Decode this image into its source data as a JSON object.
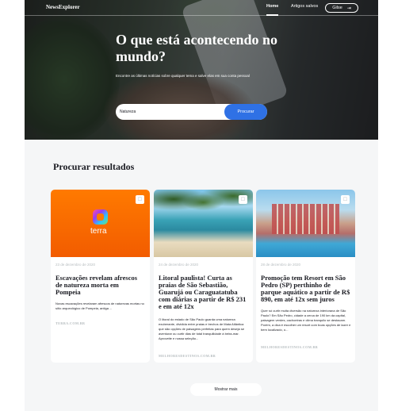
{
  "header": {
    "logo": "NewsExplorer",
    "nav": {
      "home": "Home",
      "saved": "Artigos salvos",
      "user": "Gilse"
    },
    "logout_icon": "logout-icon"
  },
  "hero": {
    "title": "O que está acontecendo no mundo?",
    "subtitle": "Encontre as últimas notícias sobre qualquer tema e salve elas em sua conta pessoal",
    "search": {
      "value": "Natureza",
      "button": "Procurar"
    }
  },
  "results": {
    "heading": "Procurar resultados",
    "cards": [
      {
        "image": "terra-logo",
        "logo_text": "terra",
        "date": "23 de dezembro de 2020",
        "title": "Escavações revelam afrescos de natureza morta em Pompeia",
        "text": "Novas escavações revelaram afrescos de naturezas mortas no sítio arqueológico de Pompeia, antiga ...",
        "source": "TERRA.COM.BR"
      },
      {
        "image": "beach-photo",
        "date": "24 de dezembro de 2020",
        "title": "Litoral paulista! Curta as praias de São Sebastião, Guarujá ou Caraguatatuba com diárias a partir de R$ 231 e em até 12x",
        "text": "O litoral do estado de São Paulo guarda uma natureza exuberante, dividida entre praias e trechos de Mata Atlântica que são opções de paisagens perfeitas para quem deseja se aventurar ou curtir dias de total tranquilidade à beira-mar. Aproveite e nossa seleção...",
        "source": "MELHORESDESTINOS.COM.BR"
      },
      {
        "image": "resort-photo",
        "date": "28 de dezembro de 2020",
        "title": "Promoção tem Resort em São Pedro (SP) perthinho de parque aquático a partir de R$ 890, em até 12x sem juros",
        "text": "Quer só curtir muita diversão na natureza interiorana de São Paulo? Em São Pedro, cidade a cerca de 190 km da capital, paisagem verdes, cachoeiras e clima tranquilo se destacam. Porém, a dica é escolher um resort com boas opções de lazer e bem localizado, o...",
        "source": "MELHORESDESTINOS.COM.BR"
      }
    ],
    "more_button": "Mostrar mais"
  },
  "colors": {
    "accent": "#2f71e5",
    "terra_orange": "#f25c00",
    "muted": "#b6bcbf"
  }
}
